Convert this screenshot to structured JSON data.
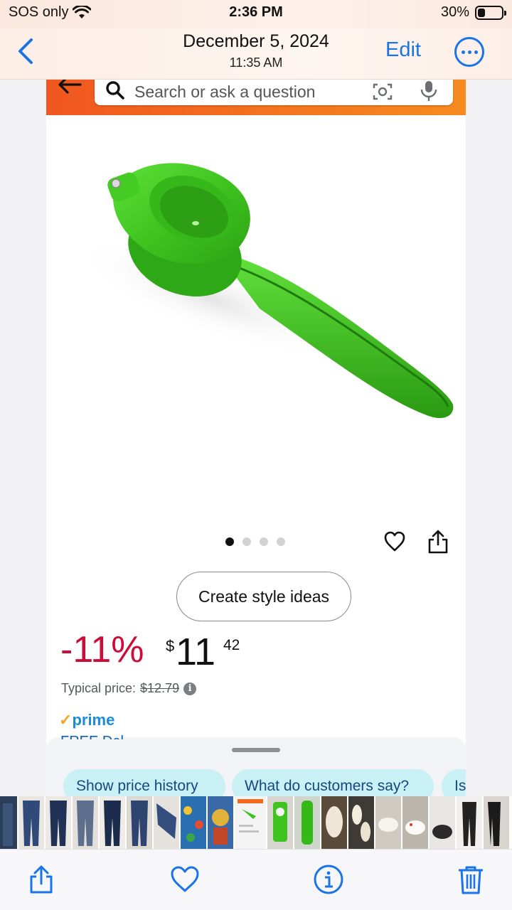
{
  "status_bar": {
    "carrier": "SOS only",
    "time": "2:36 PM",
    "battery_percent": "30%",
    "battery_level": 0.3,
    "icons": [
      "wifi-icon",
      "battery-icon"
    ]
  },
  "photos_header": {
    "date": "December 5, 2024",
    "time": "11:35 AM",
    "edit_label": "Edit",
    "icons": [
      "back-chevron-icon",
      "more-ellipsis-icon"
    ]
  },
  "amazon": {
    "search_placeholder": "Search or ask a question",
    "icons": [
      "back-arrow-icon",
      "search-icon",
      "camera-icon",
      "microphone-icon"
    ],
    "gallery": {
      "image_count": 4,
      "active_index": 0
    },
    "style_ideas_label": "Create style ideas",
    "discount": "-11%",
    "price_symbol": "$",
    "price_whole": "11",
    "price_fraction": "42",
    "typical_label": "Typical price:",
    "typical_price": "$12.79",
    "prime_check": "✓",
    "prime_label": "prime",
    "free_delivery_partial": "FREE Del",
    "chips": [
      "Show price history",
      "What do customers say?",
      "Is"
    ]
  },
  "toolbar": {
    "icons": [
      "share-icon",
      "heart-icon",
      "info-icon",
      "trash-icon"
    ]
  },
  "colors": {
    "ios_blue": "#1a74e8",
    "amazon_orange": "#f0561f",
    "discount_red": "#cc0c39",
    "product_green": "#3fc41f",
    "prime_blue": "#1a8cd8",
    "chip_bg": "#c9f0f4"
  }
}
